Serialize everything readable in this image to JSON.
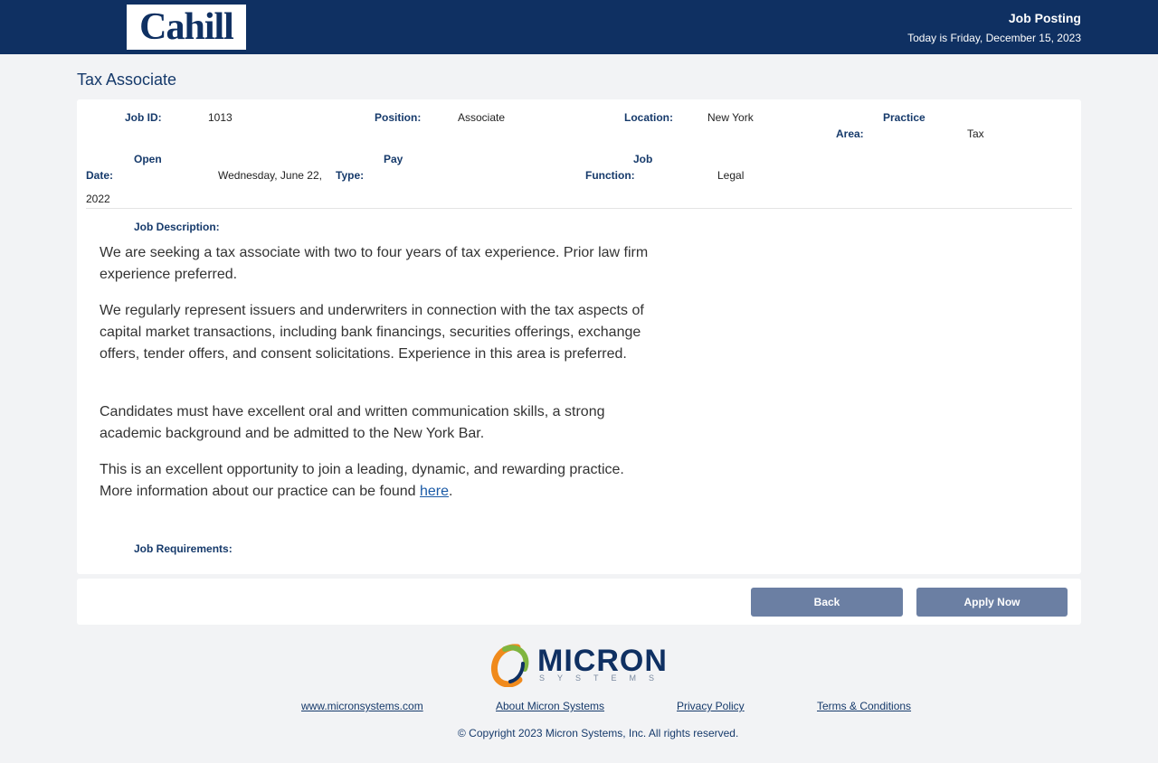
{
  "header": {
    "logo_text": "Cahill",
    "title": "Job Posting",
    "date_text": "Today is Friday, December 15, 2023"
  },
  "page_title": "Tax Associate",
  "job": {
    "job_id_label": "Job ID:",
    "job_id": "1013",
    "position_label": "Position:",
    "position": "Associate",
    "location_label": "Location:",
    "location": "New York",
    "practice_area_label_1": "Practice",
    "practice_area_label_2": "Area:",
    "practice_area": "Tax",
    "open_date_label_1": "Open",
    "open_date_label_2": "Date:",
    "open_date_1": "Wednesday, June 22,",
    "open_date_2": "2022",
    "pay_type_label_1": "Pay",
    "pay_type_label_2": "Type:",
    "job_function_label_1": "Job",
    "job_function_label_2": "Function:",
    "job_function": "Legal"
  },
  "description": {
    "label": "Job Description:",
    "paragraphs": [
      "We are seeking a tax associate with two to four years of tax experience. Prior law firm experience preferred.",
      "We regularly represent issuers and underwriters in connection with the tax aspects of capital market transactions, including bank financings, securities offerings, exchange offers, tender offers, and consent solicitations. Experience in this area is preferred.",
      "Candidates must have excellent oral and written communication skills, a strong academic background and be admitted to the New York Bar."
    ],
    "last_paragraph_text": "This is an excellent opportunity to join a leading, dynamic, and rewarding practice. More information about our practice can be found ",
    "last_paragraph_link": "here",
    "last_paragraph_end": "."
  },
  "requirements": {
    "label": "Job Requirements:"
  },
  "buttons": {
    "back": "Back",
    "apply": "Apply Now"
  },
  "footer": {
    "logo_word": "MICRON",
    "logo_sub": "SYSTEMS",
    "links": [
      "www.micronsystems.com",
      "About Micron Systems",
      "Privacy Policy",
      "Terms & Conditions"
    ],
    "copyright": "© Copyright 2023 Micron Systems, Inc. All rights reserved."
  },
  "colors": {
    "header_bg": "#0f3062",
    "button_bg": "#6b7fa3",
    "logo_orange": "#f08a1c",
    "logo_green": "#7fb53f"
  }
}
